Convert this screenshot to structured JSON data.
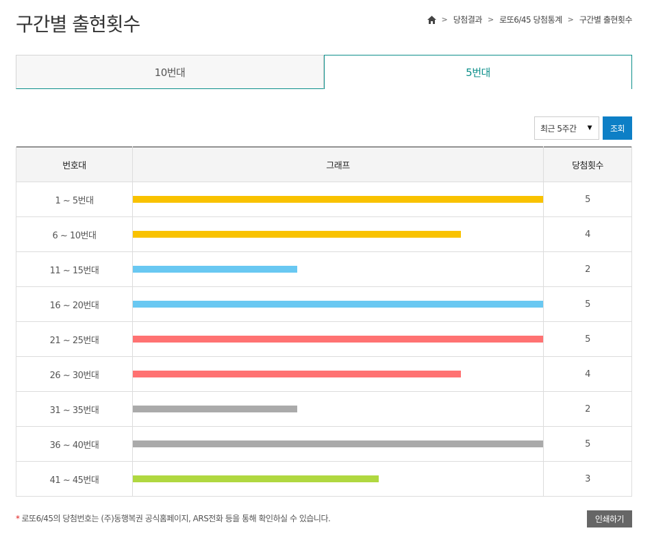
{
  "page": {
    "title": "구간별 출현횟수"
  },
  "breadcrumb": {
    "home_icon": "home-icon",
    "items": [
      "당첨결과",
      "로또6/45 당첨통계",
      "구간별 출현횟수"
    ]
  },
  "tabs": [
    {
      "label": "10번대",
      "active": false
    },
    {
      "label": "5번대",
      "active": true
    }
  ],
  "filter": {
    "period": "최근 5주간",
    "search_label": "조회"
  },
  "table": {
    "headers": {
      "range": "번호대",
      "graph": "그래프",
      "count": "당첨횟수"
    },
    "max_count": 5,
    "rows": [
      {
        "range": "1 ~ 5번대",
        "count": 5,
        "color": "#f9c200"
      },
      {
        "range": "6 ~ 10번대",
        "count": 4,
        "color": "#f9c200"
      },
      {
        "range": "11 ~ 15번대",
        "count": 2,
        "color": "#69c8f2"
      },
      {
        "range": "16 ~ 20번대",
        "count": 5,
        "color": "#69c8f2"
      },
      {
        "range": "21 ~ 25번대",
        "count": 5,
        "color": "#ff7272"
      },
      {
        "range": "26 ~ 30번대",
        "count": 4,
        "color": "#ff7272"
      },
      {
        "range": "31 ~ 35번대",
        "count": 2,
        "color": "#aaaaaa"
      },
      {
        "range": "36 ~ 40번대",
        "count": 5,
        "color": "#aaaaaa"
      },
      {
        "range": "41 ~ 45번대",
        "count": 3,
        "color": "#b0d840"
      }
    ]
  },
  "footer": {
    "asterisk": "*",
    "note": "로또6/45의 당첨번호는 (주)동행복권 공식홈페이지, ARS전화 등을 통해 확인하실 수 있습니다.",
    "print_label": "인쇄하기"
  },
  "colors": {
    "accent": "#0a8e89",
    "button": "#0d7fc6"
  }
}
